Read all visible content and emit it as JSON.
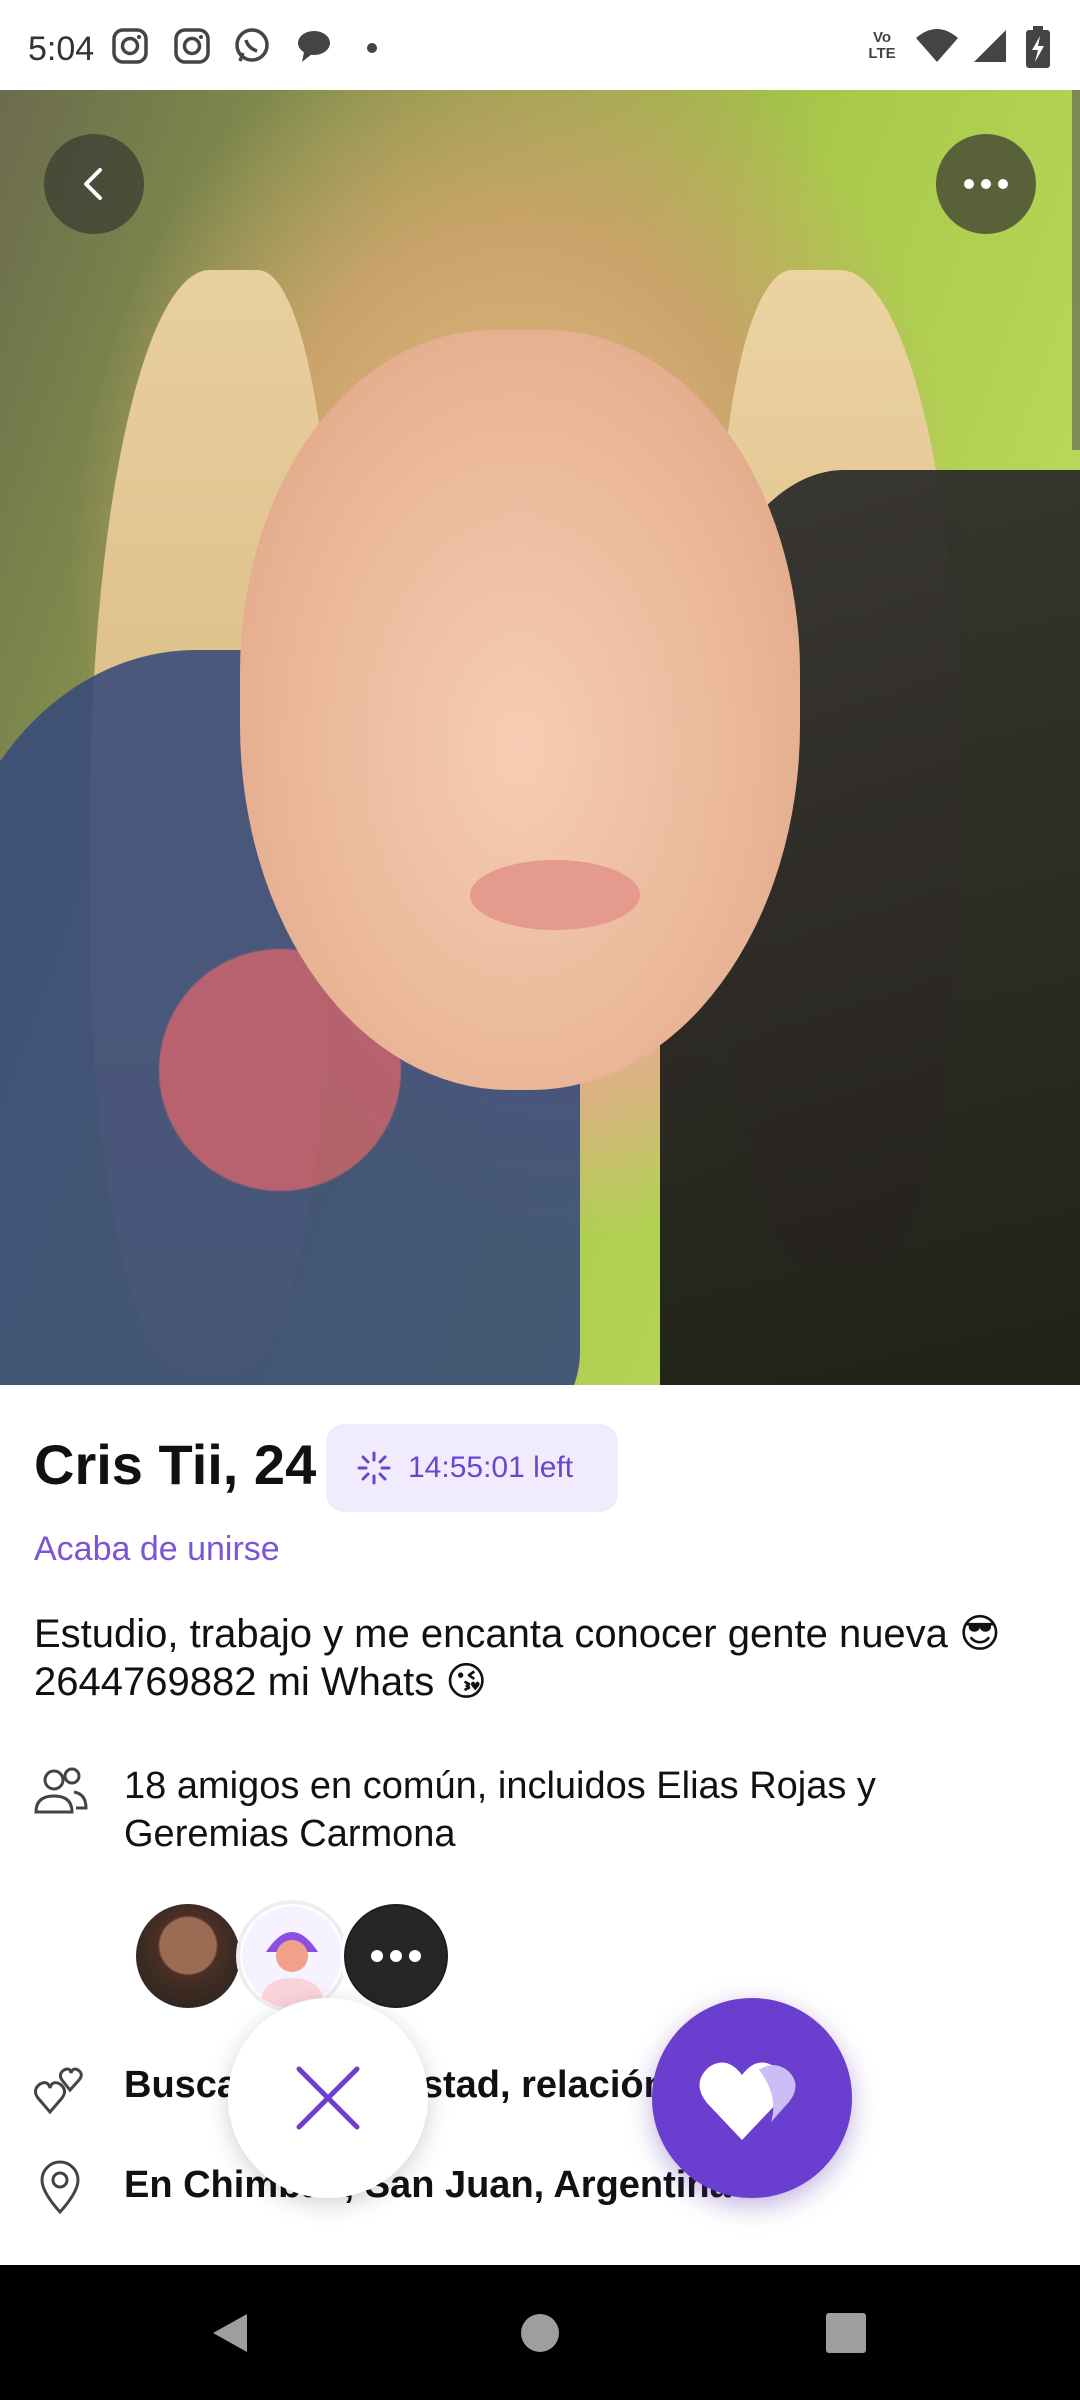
{
  "status_bar": {
    "time": "5:04",
    "notifications": [
      "instagram-icon",
      "instagram-icon",
      "whatsapp-icon",
      "chat-bubble-icon",
      "dot-icon"
    ],
    "right": [
      "volte-icon",
      "wifi-icon",
      "signal-icon",
      "battery-icon"
    ],
    "volte_label": "Vo LTE"
  },
  "profile": {
    "name_age": "Cris Tii, 24",
    "timer_text": "14:55:01 left",
    "joined": "Acaba de unirse",
    "bio_line1": "Estudio, trabajo y me encanta conocer gente nueva 😎",
    "bio_line2": "2644769882 mi Whats 😘",
    "mutual_friends": "18 amigos en común, incluidos Elias Rojas y Geremias Carmona",
    "looking_for": "Busca citas, amistad, relación estable",
    "location": "En Chimbas, San Juan, Argentina"
  },
  "colors": {
    "accent": "#6a3fd0",
    "accent_light": "#f1ecfd",
    "link": "#7a55d6"
  }
}
